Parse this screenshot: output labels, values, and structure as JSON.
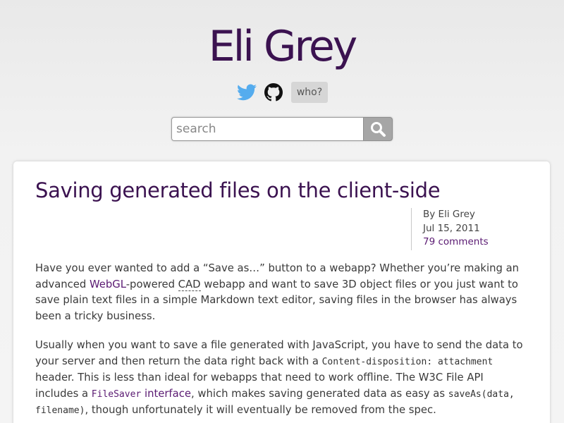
{
  "site": {
    "title": "Eli Grey",
    "who_label": "who?"
  },
  "icons": {
    "twitter": "twitter-bird-icon",
    "github": "github-octocat-icon",
    "search": "magnifier-icon"
  },
  "colors": {
    "title": "#3b1250",
    "link": "#5a1a72",
    "twitter": "#55acee"
  },
  "search": {
    "placeholder": "search"
  },
  "post": {
    "title": "Saving generated files on the client-side",
    "author": "By Eli Grey",
    "date": "Jul 15, 2011",
    "comments": "79 comments",
    "p1": {
      "t1": "Have you ever wanted to add a “Save as…” button to a webapp? Whether you’re making an advanced ",
      "link_webgl": "WebGL",
      "t2": "-powered ",
      "abbr_cad": "CAD",
      "t3": " webapp and want to save 3D object files or you just want to save plain text files in a simple Markdown text editor, saving files in the browser has always been a tricky business."
    },
    "p2": {
      "t1": "Usually when you want to save a file generated with JavaScript, you have to send the data to your server and then return the data right back with a ",
      "code_header": "Content-disposition: attachment",
      "t2": " header. This is less than ideal for webapps that need to work offline. The W3C File API includes a ",
      "code_filesaver": "FileSaver",
      "link_interface": " interface",
      "t3": ", which makes saving generated data as easy as ",
      "code_saveas": "saveAs(data, filename)",
      "t4": ", though unfortunately it will eventually be removed from the spec."
    }
  }
}
